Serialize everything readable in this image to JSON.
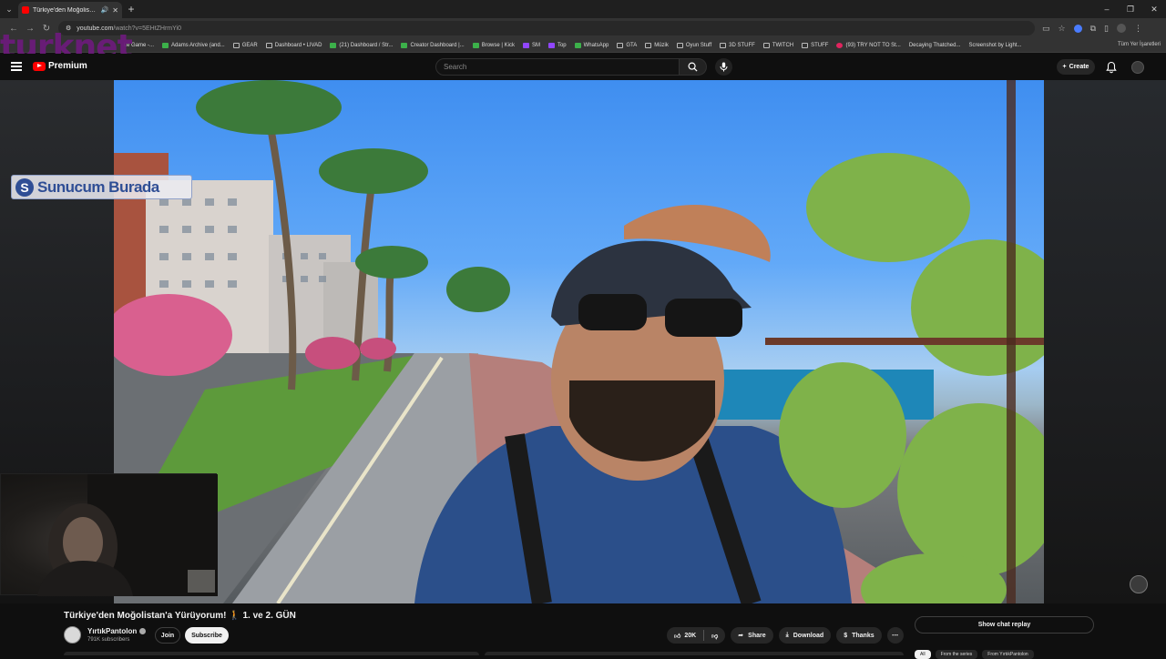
{
  "browser": {
    "tab_title": "Türkiye'den Moğolistan'a Y...",
    "new_tab": "+",
    "url_host": "youtube.com",
    "url_path": "/watch?v=5EHtZHrmYi0",
    "bookmarks": [
      "ke Game -...",
      "Adams Archive (and...",
      "GEAR",
      "Dashboard • LIVAD",
      "(21) Dashboard / Str...",
      "Creator Dashboard |...",
      "Browse | Kick",
      "SM",
      "Top",
      "WhatsApp",
      "GTA",
      "Müzik",
      "Oyun Stuff",
      "3D STUFF",
      "TWITCH",
      "STUFF",
      "(93) TRY NOT TO St...",
      "Decaying Thatched...",
      "Screenshot by Light..."
    ],
    "bookmarks_all": "Tüm Yer İşaretleri"
  },
  "overlay": {
    "logo_text": "turknet",
    "sign_badge": "Sunucum Burada"
  },
  "youtube": {
    "logo_label": "Premium",
    "search_placeholder": "Search",
    "create_label": "Create"
  },
  "video": {
    "title": "Türkiye'den Moğolistan'a Yürüyorum! 🚶 1. ve 2. GÜN",
    "channel_name": "YırtıkPantolon",
    "subscribers": "791K subscribers",
    "join_label": "Join",
    "subscribe_label": "Subscribe",
    "like_count": "20K",
    "share_label": "Share",
    "download_label": "Download",
    "thanks_label": "Thanks",
    "chat_replay_label": "Show chat replay",
    "chips": [
      "All",
      "From the series",
      "From YırtıkPantolon"
    ]
  },
  "colors": {
    "brand_red": "#ff0000",
    "background": "#0f0f0f",
    "overlay_purple": "#6b1b7a"
  }
}
